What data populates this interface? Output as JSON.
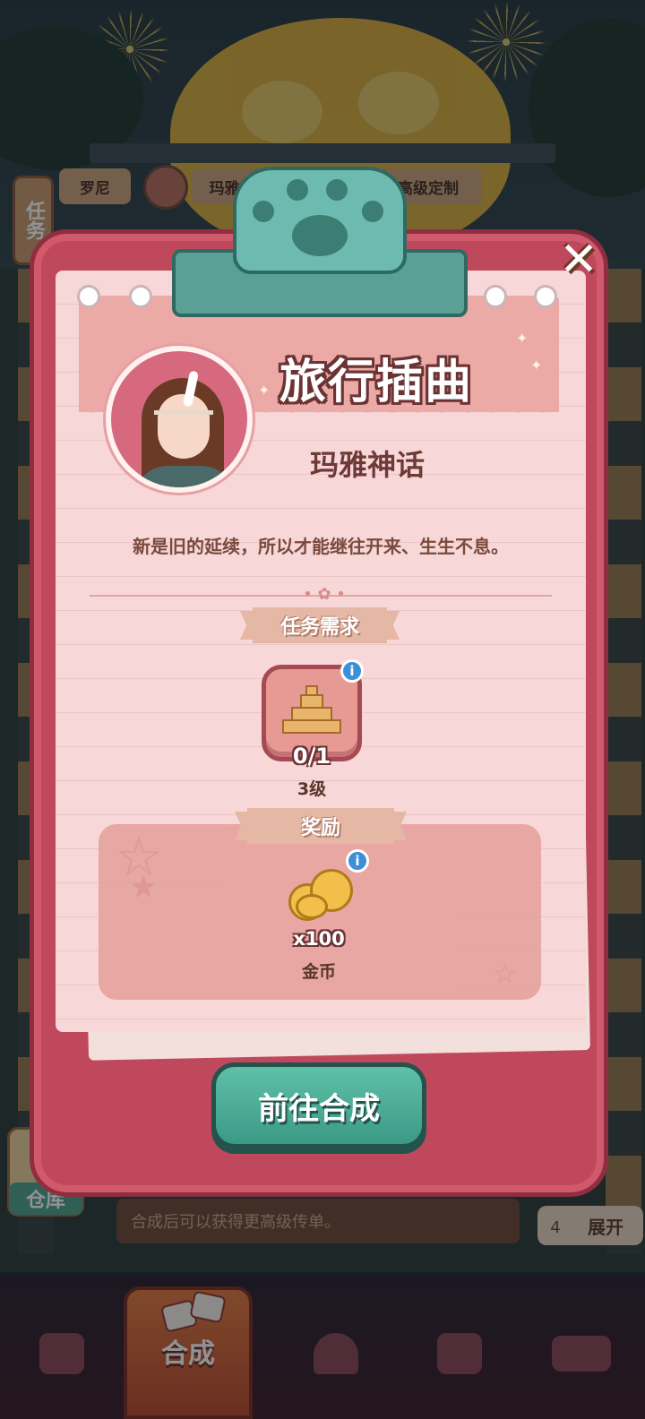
{
  "popup": {
    "title": "旅行插曲",
    "character_name": "玛雅神话",
    "description": "新是旧的延续，所以才能继往开来、生生不息。",
    "close_glyph": "✕",
    "requirement": {
      "section_label": "任务需求",
      "item_icon": "pyramid-icon",
      "progress": "0/1",
      "level": "3级"
    },
    "reward": {
      "section_label": "奖励",
      "item_icon": "paw-coin-icon",
      "amount": "x100",
      "name": "金币"
    },
    "go_button": "前往合成",
    "info_glyph": "i"
  },
  "background": {
    "task_tab": "任务",
    "chips": [
      "罗尼",
      "玛雅神",
      "高级定制"
    ],
    "warehouse": "仓库",
    "hint": "合成后可以获得更高级传单。",
    "count": "4",
    "expand": "展开"
  },
  "bottom_nav": {
    "merge_label": "合成",
    "items": [
      "shop-bag-icon",
      "merge-icon",
      "service-bell-icon",
      "map-pin-icon",
      "bus-icon"
    ]
  },
  "colors": {
    "board_red": "#c0485c",
    "paper_pink": "#f7d7d8",
    "button_teal": "#3b9a86",
    "info_blue": "#3d8fd6"
  }
}
